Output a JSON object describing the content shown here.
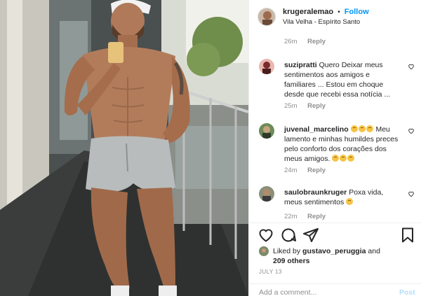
{
  "header": {
    "username": "krugeralemao",
    "separator": "•",
    "follow_label": "Follow",
    "location": "Vila Velha - Espírito Santo"
  },
  "top_meta": {
    "time": "26m",
    "reply": "Reply"
  },
  "comments": [
    {
      "user": "suzipratti",
      "text": "Quero Deixar meus sentimentos aos amigos e familiares ... Estou em choque desde que recebi essa notícia ...",
      "time": "25m",
      "reply": "Reply"
    },
    {
      "user": "juvenal_marcelino",
      "text_before": "Meu lamento e minhas humildes preces pelo conforto dos corações dos meus amigos.",
      "time": "24m",
      "reply": "Reply"
    },
    {
      "user": "saulobraunkruger",
      "text": "Poxa vida, meus sentimentos",
      "time": "22m",
      "reply": "Reply"
    }
  ],
  "likes": {
    "prefix": "Liked by",
    "user": "gustavo_peruggia",
    "middle": "and",
    "others": "209 others"
  },
  "date": "JULY 13",
  "add_comment": {
    "placeholder": "Add a comment...",
    "post_label": "Post"
  },
  "icons": {
    "like": "heart-outline-icon",
    "comment": "comment-bubble-icon",
    "share": "paper-plane-icon",
    "save": "bookmark-icon"
  },
  "colors": {
    "link": "#0095f6",
    "muted": "#8e8e8e",
    "text": "#262626",
    "post_disabled": "#b2dffc"
  }
}
